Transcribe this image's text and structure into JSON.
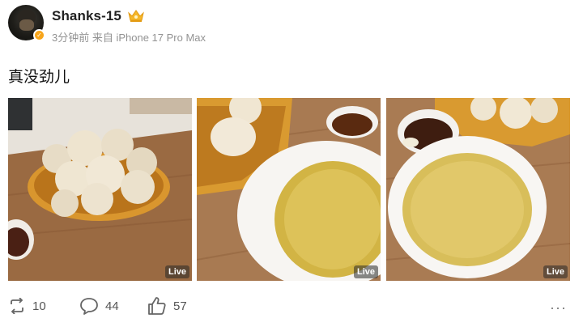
{
  "post": {
    "author": "Shanks-15",
    "meta": "3分钟前 来自 iPhone 17 Pro Max",
    "text": "真没劲儿",
    "photos": [
      {
        "badge": "Live",
        "subject": "steamed buns in wicker basket"
      },
      {
        "badge": "Live",
        "subject": "buns and bowl of millet soup"
      },
      {
        "badge": "Live",
        "subject": "bowl of millet soup and dipping sauce"
      }
    ]
  },
  "actions": {
    "repost_count": "10",
    "comment_count": "44",
    "like_count": "57",
    "more": "···"
  },
  "icons": {
    "avatar": "avatar",
    "verified": "verified-badge-icon",
    "crown": "crown-icon",
    "repost": "repost-icon",
    "comment": "comment-icon",
    "like": "thumbs-up-icon",
    "more": "more-icon"
  },
  "colors": {
    "verified": "#f7a51b",
    "crown": "#f5b72a",
    "meta_text": "#939393"
  }
}
